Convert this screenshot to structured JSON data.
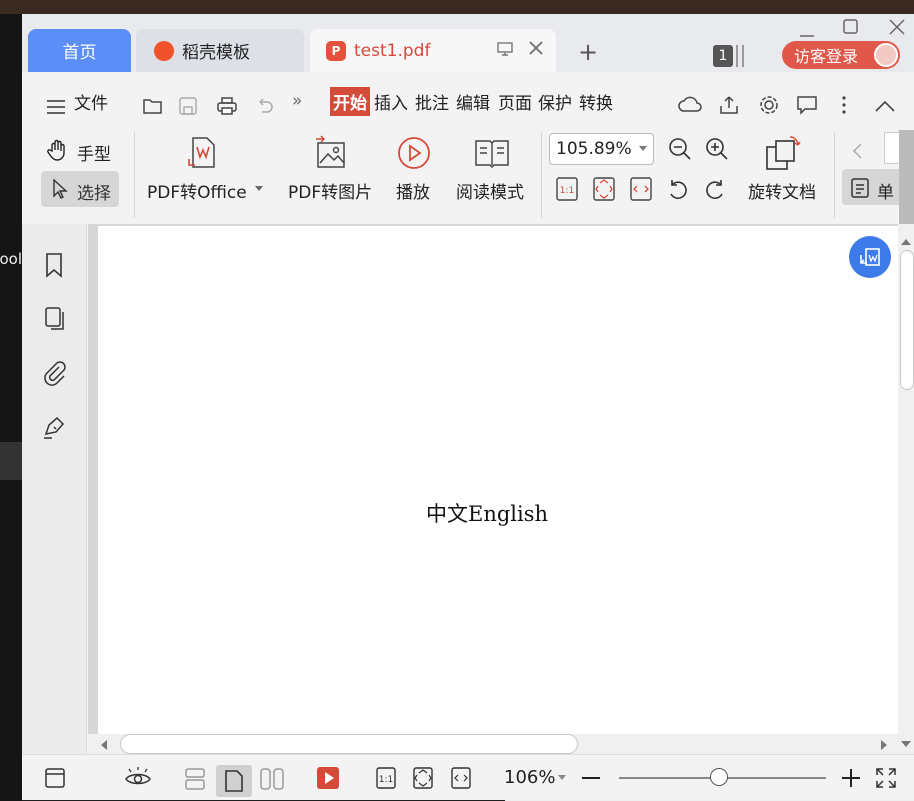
{
  "tabs": {
    "home": "首页",
    "templates": "稻壳模板",
    "pdf": "test1.pdf"
  },
  "account": {
    "badge": "1",
    "login": "访客登录"
  },
  "menu": {
    "file": "文件",
    "start": "开始",
    "insert": "插入",
    "annotate": "批注",
    "edit": "编辑",
    "page": "页面",
    "protect": "保护",
    "convert": "转换"
  },
  "ribbon": {
    "hand": "手型",
    "select": "选择",
    "pdf_to_office": "PDF转Office",
    "pdf_to_image": "PDF转图片",
    "play": "播放",
    "read_mode": "阅读模式",
    "zoom": "105.89%",
    "rotate_doc": "旋转文档",
    "single": "单"
  },
  "document": {
    "text": "中文English"
  },
  "status": {
    "zoom": "106%"
  },
  "background": {
    "left_label": "ool"
  },
  "colors": {
    "accent": "#5b8ef7",
    "brand_red": "#d64a3a"
  }
}
